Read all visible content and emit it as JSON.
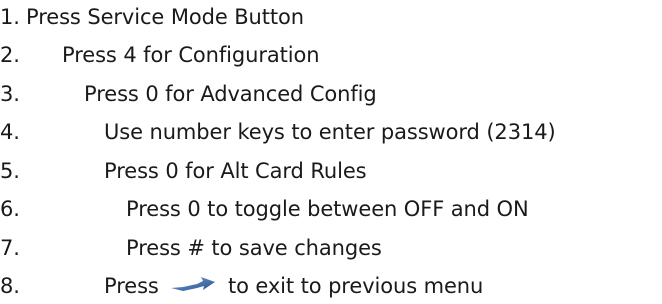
{
  "steps": [
    {
      "number": "1.",
      "text": "Press Service Mode Button"
    },
    {
      "number": "2.",
      "text": "Press 4 for Configuration"
    },
    {
      "number": "3.",
      "text": "Press 0 for Advanced Config"
    },
    {
      "number": "4.",
      "text": "Use number keys to enter password (2314)"
    },
    {
      "number": "5.",
      "text": "Press 0 for Alt Card Rules"
    },
    {
      "number": "6.",
      "text": "Press 0 to toggle between OFF and ON"
    },
    {
      "number": "7.",
      "text": "Press # to save changes"
    },
    {
      "number": "8.",
      "text_before": "Press",
      "icon": "back-arrow-icon",
      "text_after": "to exit to previous menu"
    }
  ]
}
